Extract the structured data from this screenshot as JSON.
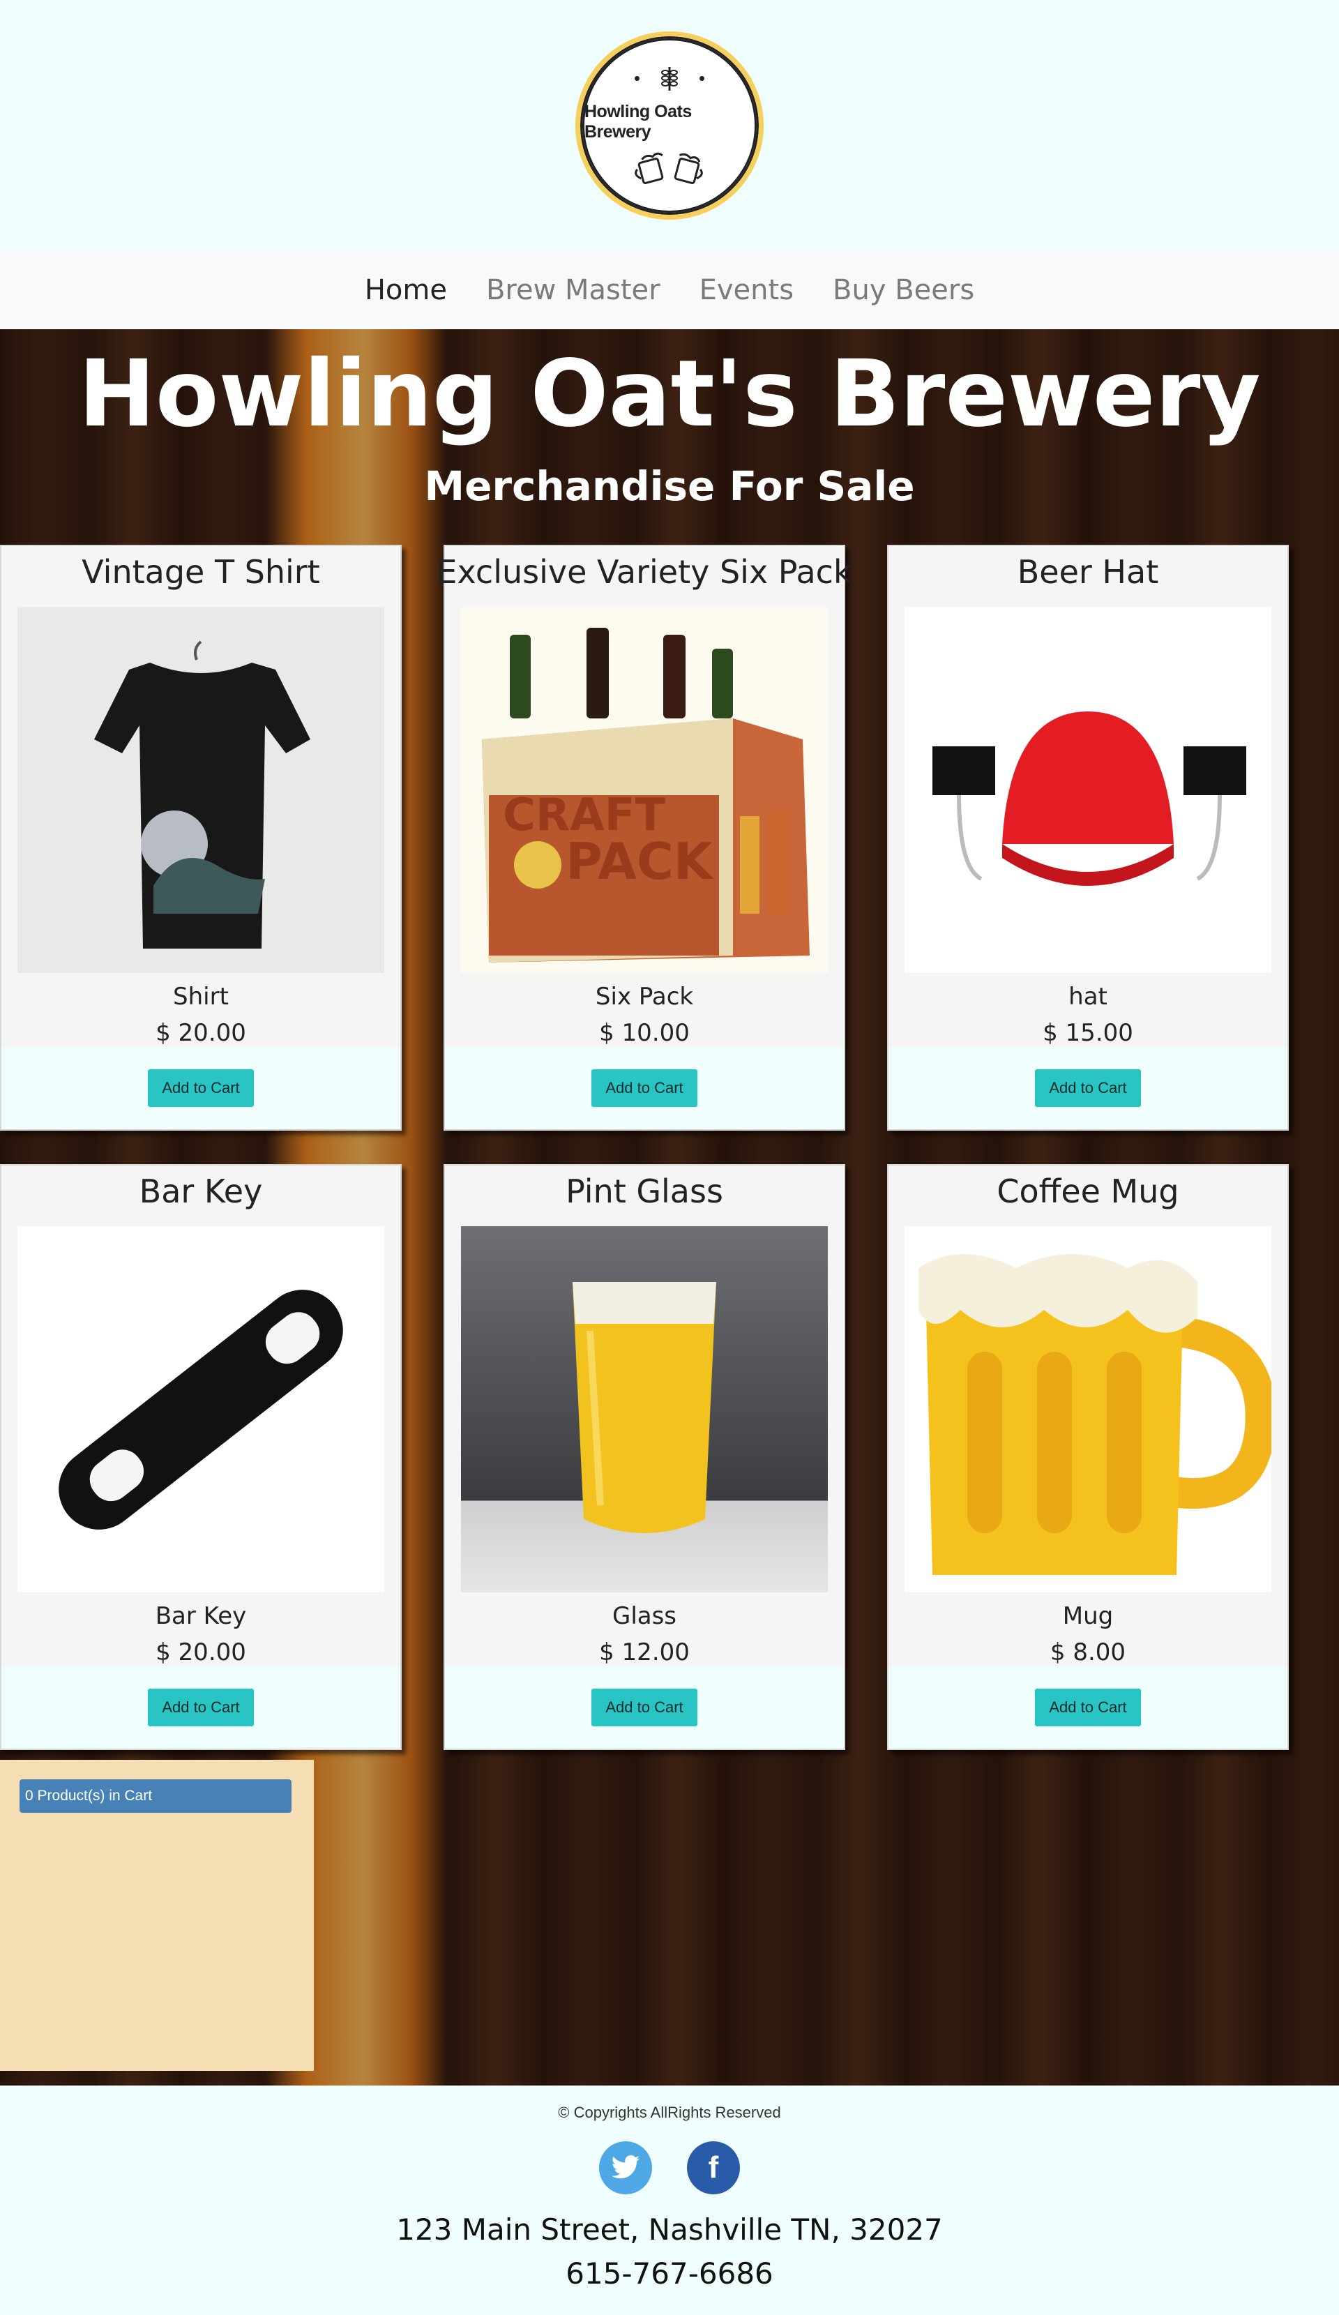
{
  "logo": {
    "text": "Howling Oats Brewery"
  },
  "nav": {
    "items": [
      "Home",
      "Brew Master",
      "Events",
      "Buy Beers"
    ]
  },
  "hero": {
    "title": "Howling Oat's Brewery",
    "subtitle": "Merchandise For Sale"
  },
  "products": [
    {
      "title": "Vintage T Shirt",
      "name": "Shirt",
      "price": "$ 20.00",
      "button": "Add to Cart",
      "icon": "tshirt-image"
    },
    {
      "title": "Exclusive Variety Six Pack",
      "name": "Six Pack",
      "price": "$ 10.00",
      "button": "Add to Cart",
      "icon": "six-pack-image"
    },
    {
      "title": "Beer Hat",
      "name": "hat",
      "price": "$ 15.00",
      "button": "Add to Cart",
      "icon": "beer-hat-image"
    },
    {
      "title": "Bar Key",
      "name": "Bar Key",
      "price": "$ 20.00",
      "button": "Add to Cart",
      "icon": "bar-key-image"
    },
    {
      "title": "Pint Glass",
      "name": "Glass",
      "price": "$ 12.00",
      "button": "Add to Cart",
      "icon": "pint-glass-image"
    },
    {
      "title": "Coffee Mug",
      "name": "Mug",
      "price": "$ 8.00",
      "button": "Add to Cart",
      "icon": "coffee-mug-image"
    }
  ],
  "cart": {
    "label": "0 Product(s) in Cart"
  },
  "footer": {
    "copyright": "© Copyrights AllRights Reserved",
    "address": "123 Main Street, Nashville TN, 32027",
    "phone": "615-767-6686"
  },
  "colors": {
    "button": "#29c4c4",
    "cart_badge": "#4782b6",
    "cart_panel": "#f5deb3"
  }
}
